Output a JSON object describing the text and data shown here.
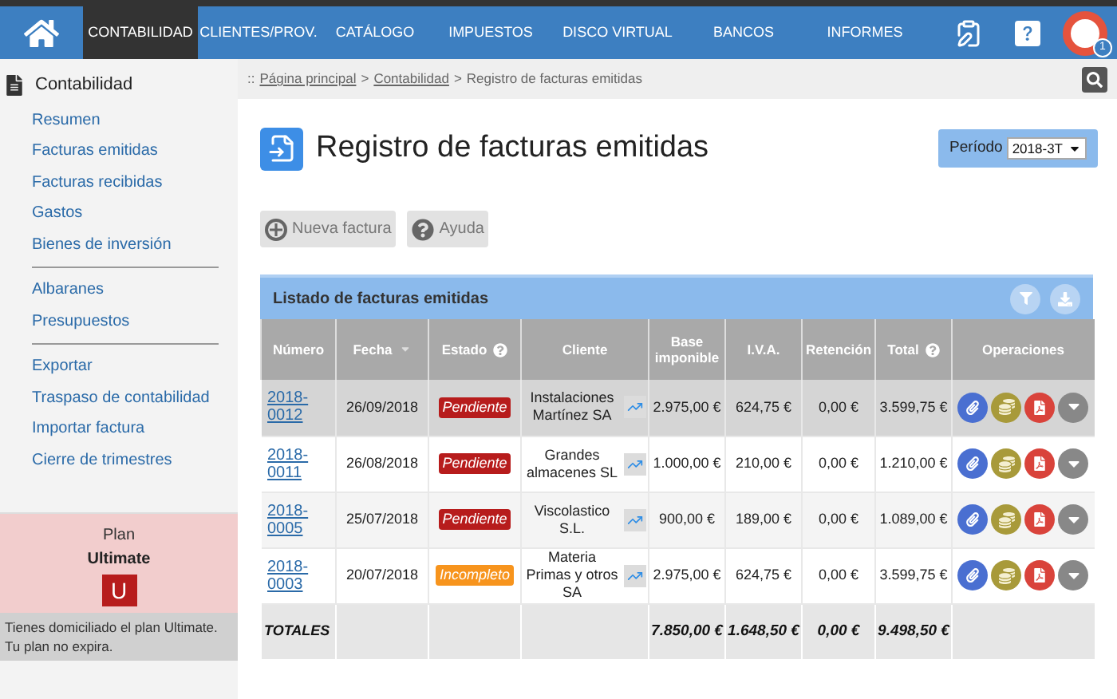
{
  "nav": {
    "tabs": [
      {
        "label": "CONTABILIDAD",
        "selected": true
      },
      {
        "label": "CLIENTES/PROV.",
        "selected": false
      },
      {
        "label": "CATÁLOGO",
        "selected": false
      },
      {
        "label": "IMPUESTOS",
        "selected": false
      },
      {
        "label": "DISCO VIRTUAL",
        "selected": false
      },
      {
        "label": "BANCOS",
        "selected": false
      },
      {
        "label": "INFORMES",
        "selected": false
      }
    ],
    "notification_count": "1"
  },
  "sidebar": {
    "title": "Contabilidad",
    "groups": [
      [
        "Resumen",
        "Facturas emitidas",
        "Facturas recibidas",
        "Gastos",
        "Bienes de inversión"
      ],
      [
        "Albaranes",
        "Presupuestos"
      ],
      [
        "Exportar",
        "Traspaso de contabilidad",
        "Importar factura",
        "Cierre de trimestres"
      ]
    ],
    "plan": {
      "label": "Plan",
      "name": "Ultimate",
      "badge": "U",
      "notes": [
        "Tienes domiciliado el plan Ultimate.",
        "Tu plan no expira."
      ]
    }
  },
  "breadcrumb": {
    "prefix": "::",
    "links": [
      "Página principal",
      "Contabilidad"
    ],
    "separator": ">",
    "current": "Registro de facturas emitidas"
  },
  "title": "Registro de facturas emitidas",
  "period": {
    "label": "Período",
    "value": "2018-3T"
  },
  "buttons": [
    "Nueva factura",
    "Ayuda"
  ],
  "table": {
    "title": "Listado de facturas emitidas",
    "columns": [
      "Número",
      "Fecha",
      "Estado",
      "Cliente",
      "Base imponible",
      "I.V.A.",
      "Retención",
      "Total",
      "Operaciones"
    ],
    "rows": [
      {
        "selected": true,
        "numero": "2018-0012",
        "fecha": "26/09/2018",
        "estado": "Pendiente",
        "kind": "pending",
        "cliente": "Instalaciones Martínez SA",
        "base": "2.975,00 €",
        "iva": "624,75 €",
        "retencion": "0,00 €",
        "total": "3.599,75 €"
      },
      {
        "selected": false,
        "numero": "2018-0011",
        "fecha": "26/08/2018",
        "estado": "Pendiente",
        "kind": "pending",
        "cliente": "Grandes almacenes SL",
        "base": "1.000,00 €",
        "iva": "210,00 €",
        "retencion": "0,00 €",
        "total": "1.210,00 €"
      },
      {
        "selected": false,
        "numero": "2018-0005",
        "fecha": "25/07/2018",
        "estado": "Pendiente",
        "kind": "pending",
        "cliente": "Viscolastico S.L.",
        "base": "900,00 €",
        "iva": "189,00 €",
        "retencion": "0,00 €",
        "total": "1.089,00 €"
      },
      {
        "selected": false,
        "numero": "2018-0003",
        "fecha": "20/07/2018",
        "estado": "Incompleto",
        "kind": "incomplete",
        "cliente": "Materia Primas y otros SA",
        "base": "2.975,00 €",
        "iva": "624,75 €",
        "retencion": "0,00 €",
        "total": "3.599,75 €"
      }
    ],
    "totals": {
      "label": "TOTALES",
      "base": "7.850,00 €",
      "iva": "1.648,50 €",
      "retencion": "0,00 €",
      "total": "9.498,50 €"
    }
  }
}
